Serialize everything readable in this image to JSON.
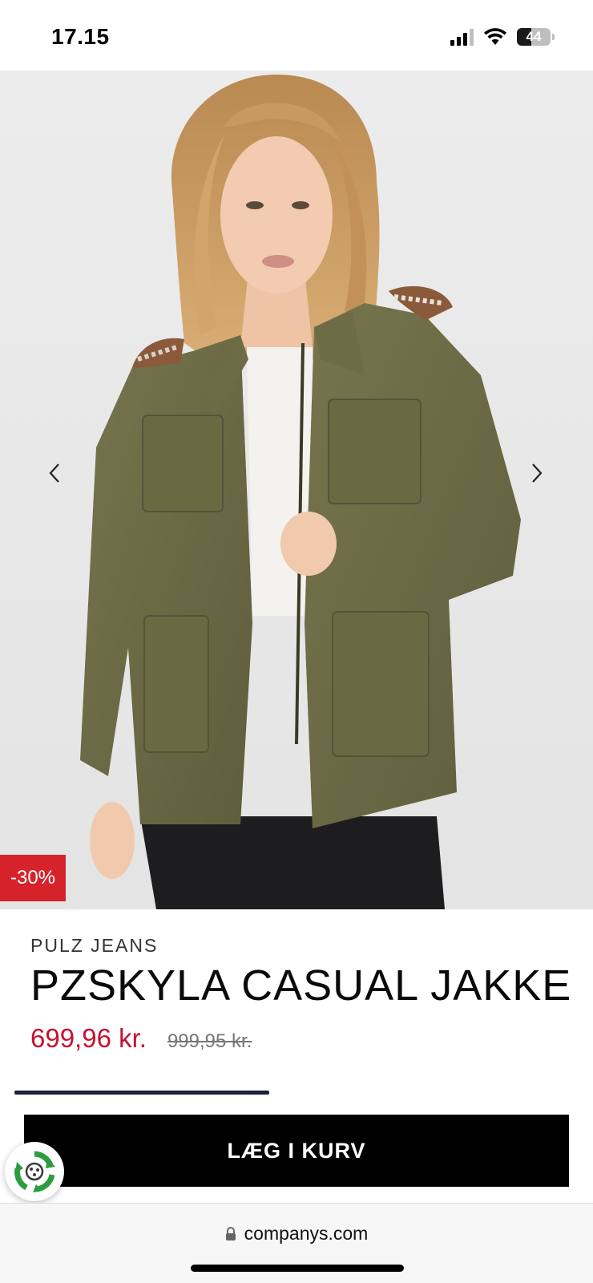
{
  "status_bar": {
    "time": "17.15",
    "battery": "44",
    "battery_level": 0.44,
    "signal_bars_active": 3,
    "signal_bars_total": 4,
    "icons": [
      "signal-icon",
      "wifi-icon",
      "battery-icon"
    ]
  },
  "product": {
    "image_alt": "PZSKYLA CASUAL JAKKE",
    "discount_badge": "-30%",
    "brand": "PULZ JEANS",
    "title": "PZSKYLA CASUAL JAKKE",
    "price_current": "699,96 kr.",
    "price_old": "999,95 kr.",
    "carousel_prev_icon": "chevron-left-icon",
    "carousel_next_icon": "chevron-right-icon",
    "gallery_progress": 0.43
  },
  "actions": {
    "add_to_cart_label": "LÆG I KURV",
    "eco_icon": "eco-recycle-icon"
  },
  "browser": {
    "url": "companys.com",
    "lock_icon": "lock-icon"
  },
  "colors": {
    "price": "#c8102e",
    "badge": "#d6232b",
    "button": "#000000",
    "jacket": "#6b6a45",
    "eco_green": "#2e9b3e"
  }
}
